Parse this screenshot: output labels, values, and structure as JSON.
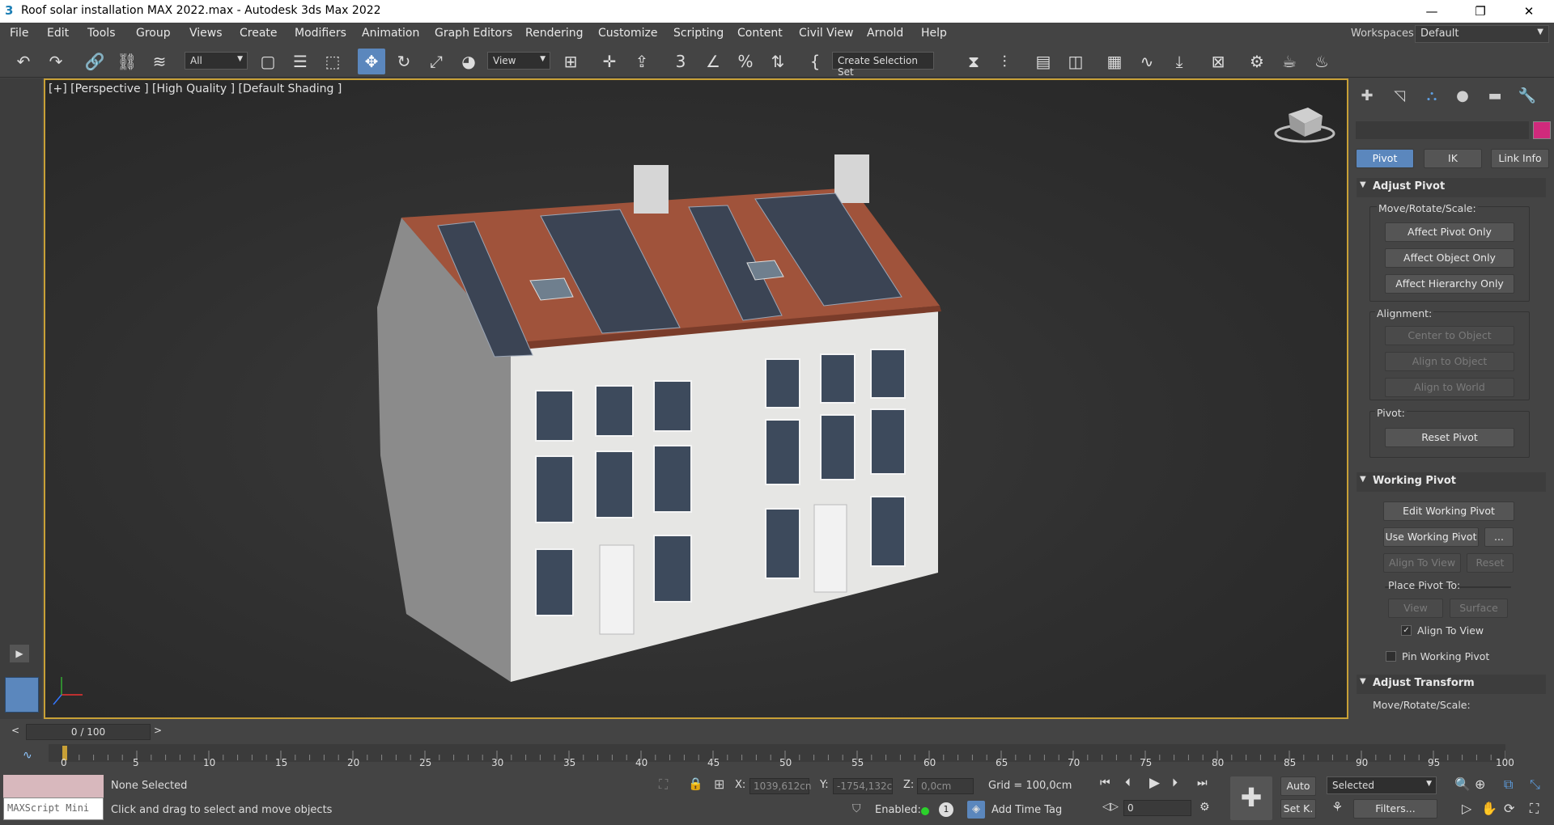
{
  "window": {
    "title": "Roof solar installation MAX 2022.max - Autodesk 3ds Max 2022",
    "app_icon": "3",
    "minimize": "—",
    "maximize": "❐",
    "close": "✕"
  },
  "menu": [
    "File",
    "Edit",
    "Tools",
    "Group",
    "Views",
    "Create",
    "Modifiers",
    "Animation",
    "Graph Editors",
    "Rendering",
    "Customize",
    "Scripting",
    "Content",
    "Civil View",
    "Arnold",
    "Help"
  ],
  "workspaces": {
    "label": "Workspaces:",
    "value": "Default"
  },
  "toolbar": {
    "filter": "All",
    "ref_coord": "View",
    "snap_3": "3",
    "selection_set": "Create Selection Set"
  },
  "viewport": {
    "label": "[+] [Perspective ] [High Quality ] [Default Shading ]"
  },
  "command_panel": {
    "tabs": [
      "create-tab",
      "modify-tab",
      "hierarchy-tab",
      "motion-tab",
      "display-tab",
      "utilities-tab"
    ],
    "swatch_color": "#d02a7c",
    "subtabs": [
      "Pivot",
      "IK",
      "Link Info"
    ],
    "adjust_pivot": {
      "title": "Adjust Pivot",
      "mrs_label": "Move/Rotate/Scale:",
      "affect_pivot": "Affect Pivot Only",
      "affect_object": "Affect Object Only",
      "affect_hierarchy": "Affect Hierarchy Only",
      "alignment_label": "Alignment:",
      "center_object": "Center to Object",
      "align_object": "Align to Object",
      "align_world": "Align to World",
      "pivot_label": "Pivot:",
      "reset_pivot": "Reset Pivot"
    },
    "working_pivot": {
      "title": "Working Pivot",
      "edit": "Edit Working Pivot",
      "use": "Use Working Pivot",
      "more": "...",
      "align_view": "Align To View",
      "reset": "Reset",
      "place_label": "Place Pivot To:",
      "view": "View",
      "surface": "Surface",
      "align_to_view_check": "Align To View",
      "pin": "Pin Working Pivot"
    },
    "adjust_transform": {
      "title": "Adjust Transform",
      "mrs_label": "Move/Rotate/Scale:"
    }
  },
  "timeline": {
    "frame": "0 / 100",
    "prev": "<",
    "next": ">",
    "ticks": [
      "0",
      "5",
      "10",
      "15",
      "20",
      "25",
      "30",
      "35",
      "40",
      "45",
      "50",
      "55",
      "60",
      "65",
      "70",
      "75",
      "80",
      "85",
      "90",
      "95",
      "100"
    ]
  },
  "status": {
    "selection": "None Selected",
    "hint": "Click and drag to select and move objects",
    "maxscript": "MAXScript Mini",
    "x_label": "X:",
    "x_val": "1039,612cn",
    "y_label": "Y:",
    "y_val": "-1754,132c",
    "z_label": "Z:",
    "z_val": "0,0cm",
    "grid": "Grid = 100,0cm",
    "enabled": "Enabled:",
    "enabled_count": "1",
    "add_time_tag": "Add Time Tag",
    "auto": "Auto",
    "set_key": "Set K.",
    "key_filter": "Selected",
    "filters": "Filters...",
    "frame_field": "0"
  }
}
